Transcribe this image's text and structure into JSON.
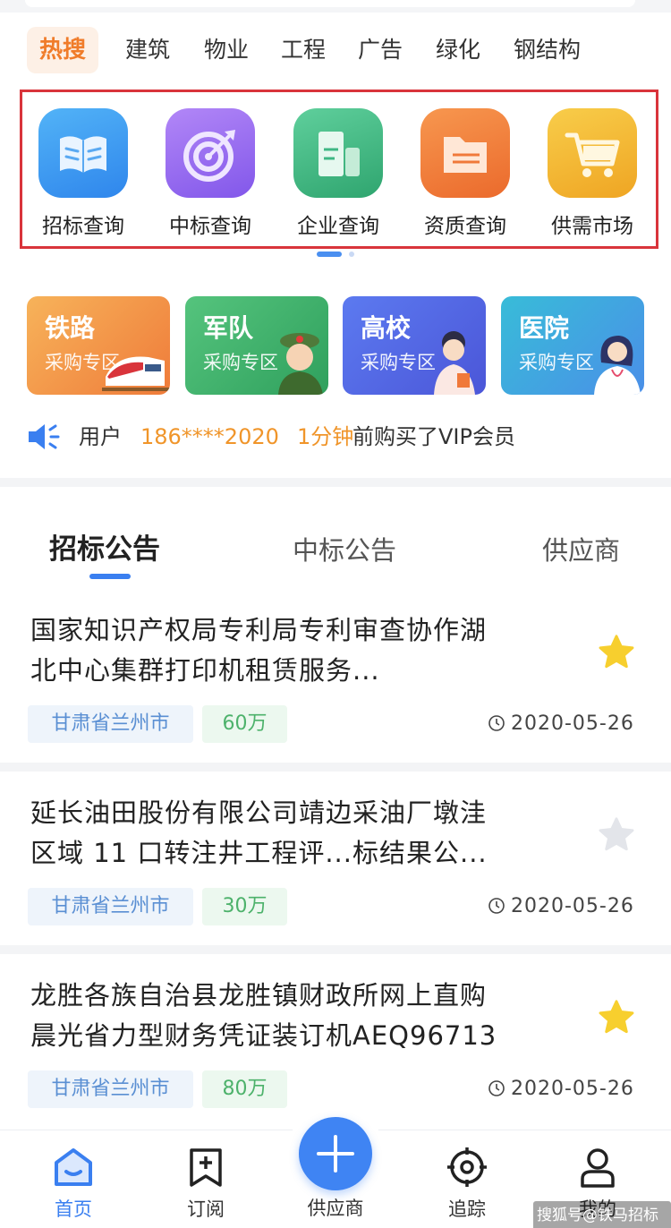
{
  "hot_search": {
    "tag": "热搜",
    "keywords": [
      "建筑",
      "物业",
      "工程",
      "广告",
      "绿化",
      "钢结构"
    ]
  },
  "features": [
    {
      "label": "招标查询",
      "icon": "book-icon",
      "color": "#3a9af0"
    },
    {
      "label": "中标查询",
      "icon": "target-icon",
      "color": "#9a6cf2"
    },
    {
      "label": "企业查询",
      "icon": "building-icon",
      "color": "#3fb784"
    },
    {
      "label": "资质查询",
      "icon": "folder-icon",
      "color": "#f0793a"
    },
    {
      "label": "供需市场",
      "icon": "cart-icon",
      "color": "#f3b52e"
    }
  ],
  "zones": [
    {
      "title": "铁路",
      "subtitle": "采购专区",
      "icon": "train-icon"
    },
    {
      "title": "军队",
      "subtitle": "采购专区",
      "icon": "soldier-icon"
    },
    {
      "title": "高校",
      "subtitle": "采购专区",
      "icon": "student-icon"
    },
    {
      "title": "医院",
      "subtitle": "采购专区",
      "icon": "doctor-icon"
    }
  ],
  "notice": {
    "prefix": "用户",
    "phone": "186****2020",
    "time": "1分钟",
    "suffix": "前购买了VIP会员"
  },
  "tabs": [
    "招标公告",
    "中标公告",
    "供应商"
  ],
  "active_tab": "招标公告",
  "items": [
    {
      "title_line1": "国家知识产权局专利局专利审查协作湖",
      "title_line2": "北中心集群打印机租赁服务...",
      "region": "甘肃省兰州市",
      "amount": "60万",
      "date": "2020-05-26",
      "starred": true
    },
    {
      "title_line1": "延长油田股份有限公司靖边采油厂墩洼",
      "title_line2": "区域 11 口转注井工程评...标结果公...",
      "region": "甘肃省兰州市",
      "amount": "30万",
      "date": "2020-05-26",
      "starred": false
    },
    {
      "title_line1": "龙胜各族自治县龙胜镇财政所网上直购",
      "title_line2": "晨光省力型财务凭证装订机AEQ96713",
      "region": "甘肃省兰州市",
      "amount": "80万",
      "date": "2020-05-26",
      "starred": true
    }
  ],
  "nav": {
    "home": "首页",
    "subscribe": "订阅",
    "supplier": "供应商",
    "track": "追踪",
    "mine": "我的"
  },
  "watermark": "搜狐号@铁马招标网",
  "colors": {
    "accent": "#3a7ff0",
    "hot": "#f07c2a",
    "highlight_box": "#d9343b",
    "star_on": "#f7cf2e",
    "star_off": "#e3e5ea"
  }
}
